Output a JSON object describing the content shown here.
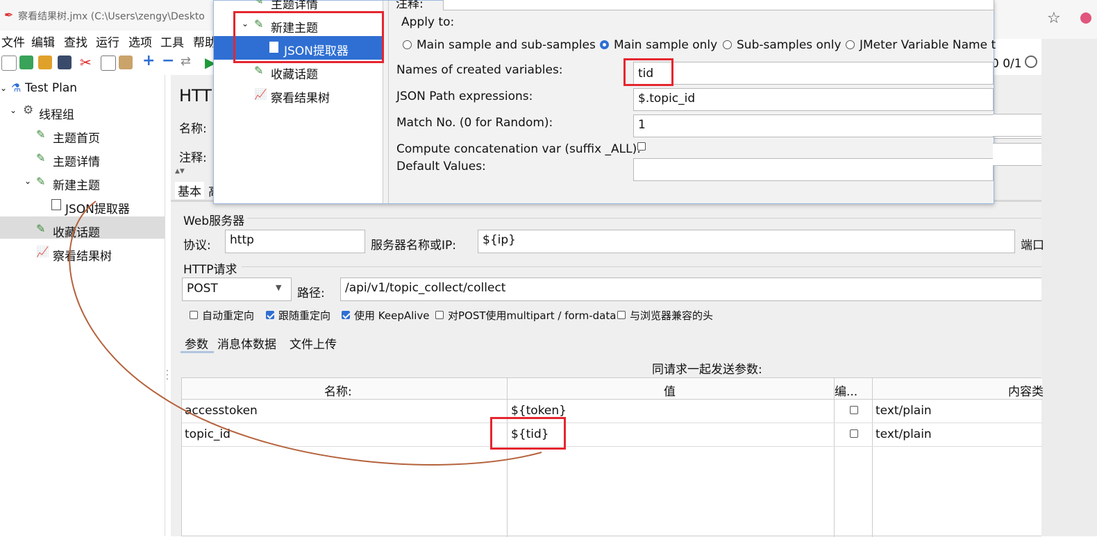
{
  "window": {
    "title": "察看结果树.jmx (C:\\Users\\zengy\\Deskto",
    "close_glyph": "✕",
    "star_glyph": "☆"
  },
  "menu": [
    "文件",
    "编辑",
    "查找",
    "运行",
    "选项",
    "工具",
    "帮助"
  ],
  "status": {
    "counter": "0 0/1"
  },
  "tree": {
    "items": [
      {
        "label": "Test Plan",
        "icon": "test-plan-icon"
      },
      {
        "label": "线程组",
        "icon": "gear-icon"
      },
      {
        "label": "主题首页",
        "icon": "sampler-pen-icon"
      },
      {
        "label": "主题详情",
        "icon": "sampler-pen-icon"
      },
      {
        "label": "新建主题",
        "icon": "sampler-pen-icon"
      },
      {
        "label": "JSON提取器",
        "icon": "json-extractor-icon"
      },
      {
        "label": "收藏话题",
        "icon": "sampler-pen-icon"
      },
      {
        "label": "察看结果树",
        "icon": "chart-listener-icon"
      }
    ]
  },
  "overlay_tree": {
    "items": [
      {
        "label": "主题详情"
      },
      {
        "label": "新建主题"
      },
      {
        "label": "JSON提取器"
      },
      {
        "label": "收藏话题"
      },
      {
        "label": "察看结果树"
      }
    ]
  },
  "json_extractor": {
    "comment_label": "注释:",
    "apply_to_label": "Apply to:",
    "apply_options": [
      "Main sample and sub-samples",
      "Main sample only",
      "Sub-samples only",
      "JMeter Variable Name t"
    ],
    "selected_apply": "Main sample only",
    "names_label": "Names of created variables:",
    "names_value": "tid",
    "path_label": "JSON Path expressions:",
    "path_value": "$.topic_id",
    "match_label": "Match No. (0 for Random):",
    "match_value": "1",
    "concat_label": "Compute concatenation var (suffix _ALL):",
    "default_label": "Default Values:",
    "default_value": ""
  },
  "http_sampler": {
    "title_partial": "HTTP",
    "name_label": "名称:",
    "comment_label": "注释:",
    "tab_basic": "基本",
    "tab_advanced_partial": "高",
    "web_server_title": "Web服务器",
    "protocol_label": "协议:",
    "protocol_value": "http",
    "server_label": "服务器名称或IP:",
    "server_value": "${ip}",
    "port_label_partial": "端口",
    "http_request_title": "HTTP请求",
    "method_value": "POST",
    "path_label": "路径:",
    "path_value": "/api/v1/topic_collect/collect",
    "options": [
      {
        "label": "自动重定向",
        "checked": false
      },
      {
        "label": "跟随重定向",
        "checked": true
      },
      {
        "label": "使用 KeepAlive",
        "checked": true
      },
      {
        "label": "对POST使用multipart / form-data",
        "checked": false
      },
      {
        "label": "与浏览器兼容的头",
        "checked": false
      }
    ],
    "subtabs": [
      "参数",
      "消息体数据",
      "文件上传"
    ],
    "params_caption": "同请求一起发送参数:",
    "table": {
      "headers": [
        "名称:",
        "值",
        "编...",
        "内容类"
      ],
      "rows": [
        {
          "name": "accesstoken",
          "value": "${token}",
          "encode": false,
          "content_type": "text/plain"
        },
        {
          "name": "topic_id",
          "value": "${tid}",
          "encode": false,
          "content_type": "text/plain"
        }
      ]
    }
  },
  "colors": {
    "highlight": "#e5262f",
    "selection": "#2f6fd3",
    "arrow": "#b5623c"
  }
}
